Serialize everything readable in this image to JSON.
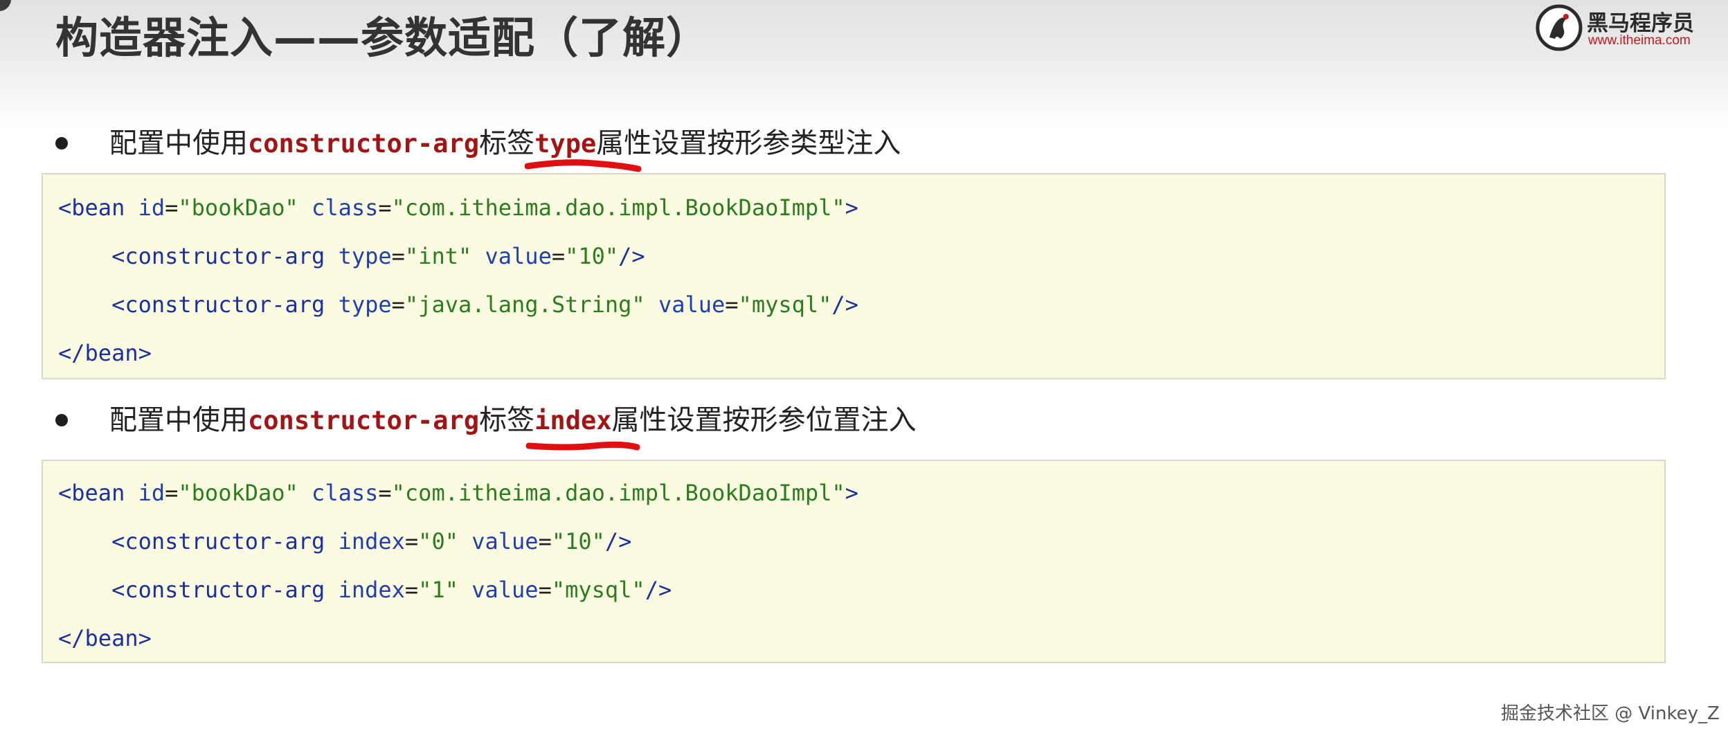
{
  "header": {
    "title": "构造器注入——参数适配（了解）",
    "logo": {
      "name": "黑马程序员",
      "url": "www.itheima.com"
    }
  },
  "sections": [
    {
      "bullet": {
        "prefix": "配置中使用",
        "keyword": "constructor-arg",
        "middle": "标签",
        "attribute": "type",
        "suffix": "属性设置按形参类型注入"
      },
      "code": {
        "bean_open": {
          "tag_start": "<bean",
          "id_attr": "id",
          "id_val": "\"bookDao\"",
          "class_attr": "class",
          "class_val": "\"com.itheima.dao.impl.BookDaoImpl\"",
          "tag_end": ">"
        },
        "args": [
          {
            "tag": "<constructor-arg",
            "a1": "type",
            "v1": "\"int\"",
            "a2": "value",
            "v2": "\"10\"",
            "close": "/>"
          },
          {
            "tag": "<constructor-arg",
            "a1": "type",
            "v1": "\"java.lang.String\"",
            "a2": "value",
            "v2": "\"mysql\"",
            "close": "/>"
          }
        ],
        "bean_close": "</bean>"
      }
    },
    {
      "bullet": {
        "prefix": "配置中使用",
        "keyword": "constructor-arg",
        "middle": "标签",
        "attribute": "index",
        "suffix": "属性设置按形参位置注入"
      },
      "code": {
        "bean_open": {
          "tag_start": "<bean",
          "id_attr": "id",
          "id_val": "\"bookDao\"",
          "class_attr": "class",
          "class_val": "\"com.itheima.dao.impl.BookDaoImpl\"",
          "tag_end": ">"
        },
        "args": [
          {
            "tag": "<constructor-arg",
            "a1": "index",
            "v1": "\"0\"",
            "a2": "value",
            "v2": "\"10\"",
            "close": "/>"
          },
          {
            "tag": "<constructor-arg",
            "a1": "index",
            "v1": "\"1\"",
            "a2": "value",
            "v2": "\"mysql\"",
            "close": "/>"
          }
        ],
        "bean_close": "</bean>"
      }
    }
  ],
  "watermark": "掘金技术社区 @ Vinkey_Z",
  "colors": {
    "keyword": "#a31515",
    "underline": "#e01010",
    "code_bg": "#fbfbe2",
    "tag": "#1c2fa0",
    "string": "#2a7d1c",
    "logo_url": "#c8161d"
  }
}
